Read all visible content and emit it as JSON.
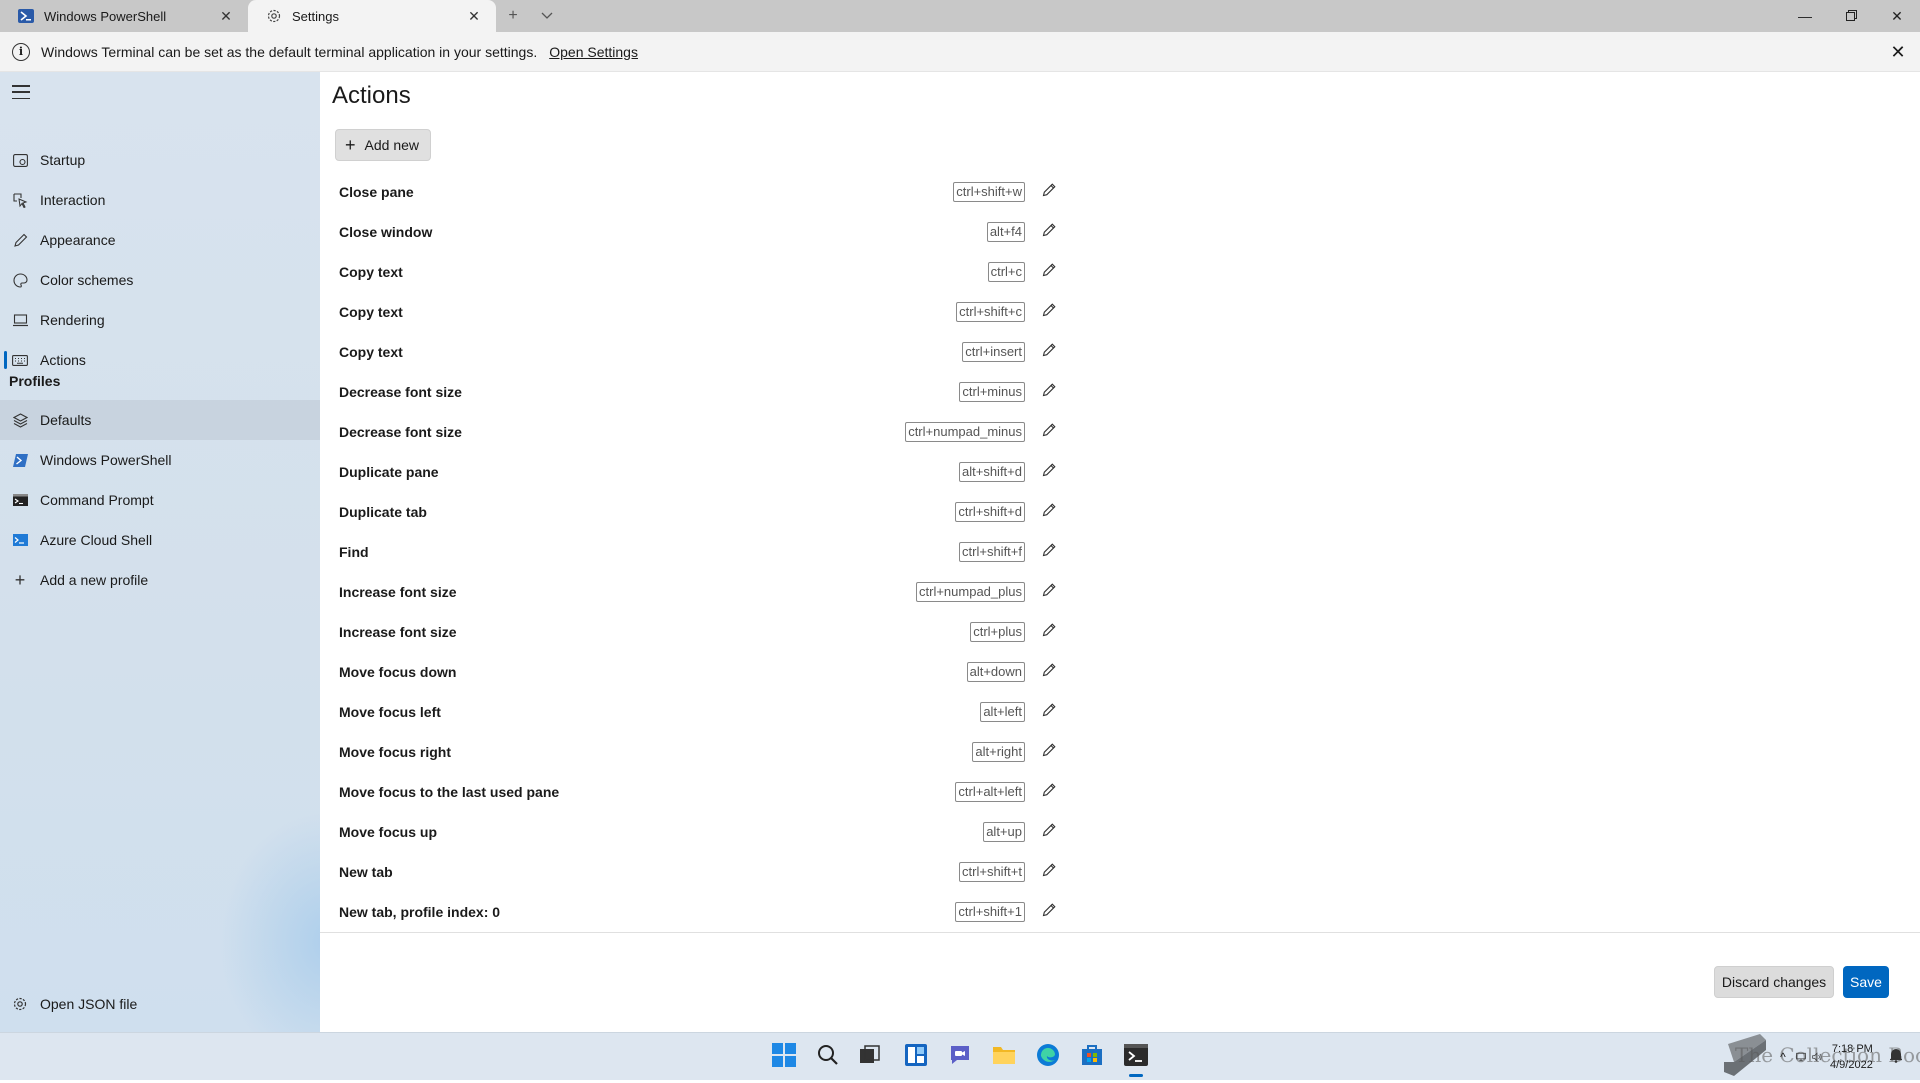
{
  "tabs": [
    {
      "label": "Windows PowerShell",
      "icon": "powershell-icon"
    },
    {
      "label": "Settings",
      "icon": "gear-icon"
    }
  ],
  "infobar": {
    "message": "Windows Terminal can be set as the default terminal application in your settings.",
    "link": "Open Settings"
  },
  "sidebar": {
    "items": [
      {
        "label": "Startup",
        "icon": "startup-icon"
      },
      {
        "label": "Interaction",
        "icon": "interaction-icon"
      },
      {
        "label": "Appearance",
        "icon": "pen-icon"
      },
      {
        "label": "Color schemes",
        "icon": "palette-icon"
      },
      {
        "label": "Rendering",
        "icon": "monitor-icon"
      },
      {
        "label": "Actions",
        "icon": "keyboard-icon"
      }
    ],
    "profiles_header": "Profiles",
    "profiles": [
      {
        "label": "Defaults",
        "icon": "layers-icon"
      },
      {
        "label": "Windows PowerShell",
        "icon": "powershell-icon"
      },
      {
        "label": "Command Prompt",
        "icon": "cmd-icon"
      },
      {
        "label": "Azure Cloud Shell",
        "icon": "azure-icon"
      },
      {
        "label": "Add a new profile",
        "icon": "plus-icon"
      }
    ],
    "open_json": "Open JSON file"
  },
  "main": {
    "title": "Actions",
    "add_new": "Add new",
    "actions": [
      {
        "name": "Close pane",
        "keys": "ctrl+shift+w"
      },
      {
        "name": "Close window",
        "keys": "alt+f4"
      },
      {
        "name": "Copy text",
        "keys": "ctrl+c"
      },
      {
        "name": "Copy text",
        "keys": "ctrl+shift+c"
      },
      {
        "name": "Copy text",
        "keys": "ctrl+insert"
      },
      {
        "name": "Decrease font size",
        "keys": "ctrl+minus"
      },
      {
        "name": "Decrease font size",
        "keys": "ctrl+numpad_minus"
      },
      {
        "name": "Duplicate pane",
        "keys": "alt+shift+d"
      },
      {
        "name": "Duplicate tab",
        "keys": "ctrl+shift+d"
      },
      {
        "name": "Find",
        "keys": "ctrl+shift+f"
      },
      {
        "name": "Increase font size",
        "keys": "ctrl+numpad_plus"
      },
      {
        "name": "Increase font size",
        "keys": "ctrl+plus"
      },
      {
        "name": "Move focus down",
        "keys": "alt+down"
      },
      {
        "name": "Move focus left",
        "keys": "alt+left"
      },
      {
        "name": "Move focus right",
        "keys": "alt+right"
      },
      {
        "name": "Move focus to the last used pane",
        "keys": "ctrl+alt+left"
      },
      {
        "name": "Move focus up",
        "keys": "alt+up"
      },
      {
        "name": "New tab",
        "keys": "ctrl+shift+t"
      },
      {
        "name": "New tab, profile index: 0",
        "keys": "ctrl+shift+1"
      }
    ],
    "discard": "Discard changes",
    "save": "Save"
  },
  "taskbar": {
    "time": "7:18 PM",
    "date": "4/9/2022",
    "watermark": "The Collection Book"
  },
  "colors": {
    "accent": "#0067c0",
    "sidebar_bg": "#d8e3ee",
    "titlebar_bg": "#c8c8c8"
  }
}
